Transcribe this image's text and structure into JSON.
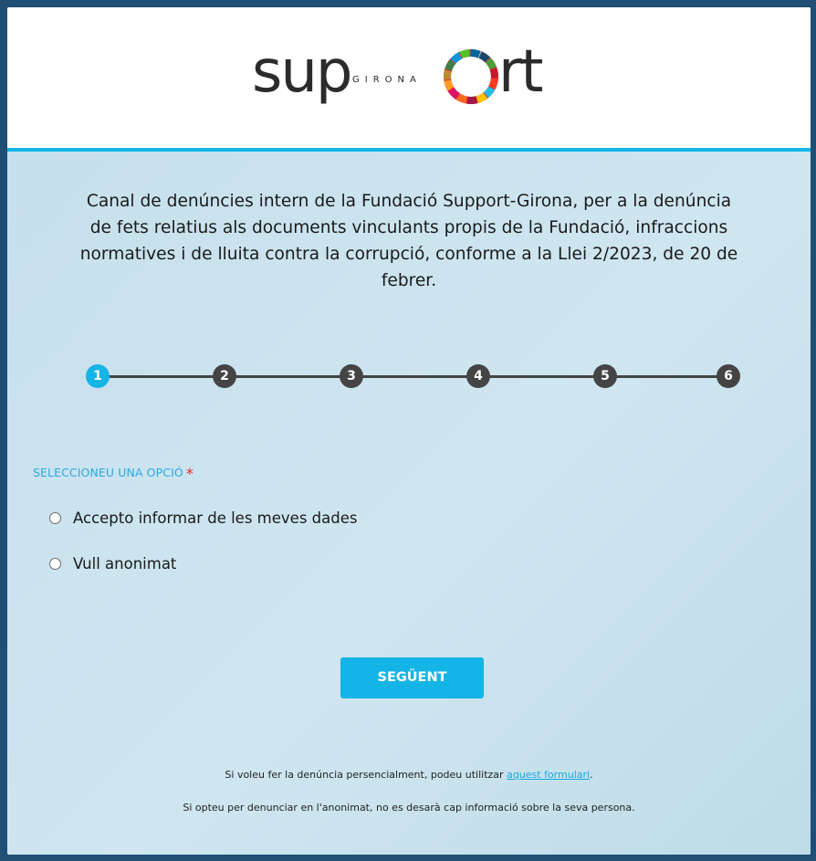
{
  "brand": {
    "logo_text_left": "sup",
    "logo_text_right": "rt",
    "logo_sub": "GIRONA",
    "accent_color": "#15b4e6"
  },
  "intro": {
    "line1": "Canal de denúncies intern de la Fundació Support-Girona, per a la denúncia",
    "line2": "de fets relatius als documents vinculants propis de la Fundació, infraccions",
    "line3": "normatives i de lluita contra la corrupció, conforme a la Llei 2/2023, de 20 de",
    "line4": "febrer."
  },
  "stepper": {
    "steps": [
      "1",
      "2",
      "3",
      "4",
      "5",
      "6"
    ],
    "current": 1
  },
  "question": {
    "label": "SELECCIONEU UNA OPCIÓ",
    "required_mark": "*",
    "options": [
      {
        "label": "Accepto informar de les meves dades",
        "selected": false
      },
      {
        "label": "Vull anonimat",
        "selected": false
      }
    ]
  },
  "actions": {
    "next_label": "SEGÜENT"
  },
  "footer": {
    "line1_text": "Si voleu fer la denúncia persencialment, podeu utilitzar",
    "line1_link": "aquest formulari",
    "line1_end": ".",
    "line2": "Si opteu per denunciar en l'anonimat, no es desarà cap informació sobre la seva persona."
  }
}
